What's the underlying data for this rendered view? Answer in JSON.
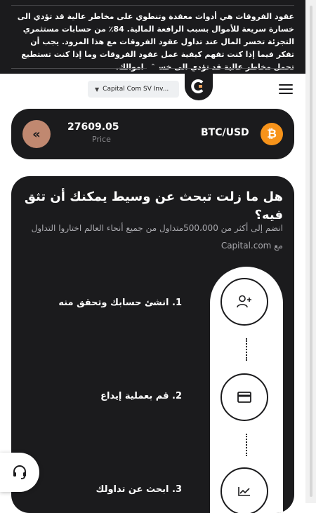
{
  "risk_warning": {
    "text": "عقود الفروقات هي أدوات معقدة وتنطوي على مخاطر عالية قد تؤدي الى خسارة سريعة للأموال بسبب الرافعة المالية. 84٪ من حسابات مستثمري التجزئة تخسر المال عند تداول عقود الفروقات مع هذا المزود. يجب أن تفكر فيما إذا كنت تفهم كيفية عمل عقود الفروقات وما إذا كنت تستطيع تحمل مخاطر عالية قد تؤدي الى خسارة اموالك.",
    "collapse_icon": "double-chevron-up"
  },
  "header": {
    "account_selector": "Capital Com SV Inv...",
    "logo": "capital-com-logo",
    "menu_icon": "hamburger-menu"
  },
  "quote": {
    "price": "27609.05",
    "price_label": "Price",
    "pair": "BTC/USD",
    "back_icon": "double-chevron-left",
    "asset_icon": "bitcoin"
  },
  "promo": {
    "title": "هل ما زلت تبحث عن وسيط يمكنك أن تثق فيه؟",
    "subtitle": "انضم إلى أكثر من 500،000متداول من جميع أنحاء العالم اختاروا التداول مع Capital.com",
    "steps": [
      {
        "label": "1. انشئ حسابك وتحقق منه",
        "icon": "add-user"
      },
      {
        "label": "2. قم بعملية إيداع",
        "icon": "credit-card"
      },
      {
        "label": "3. ابحث عن تداولك",
        "icon": "chart-line"
      }
    ]
  },
  "support": {
    "icon": "headset"
  },
  "colors": {
    "dark": "#1b1b1d",
    "accent_brown": "#c08870",
    "bitcoin_orange": "#f7931a"
  }
}
